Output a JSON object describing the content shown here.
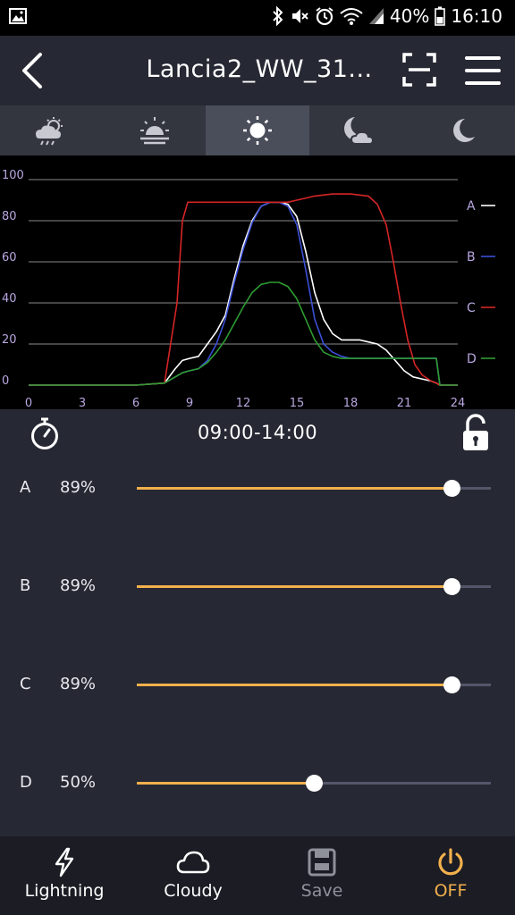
{
  "status_bar": {
    "battery": "40%",
    "time": "16:10"
  },
  "header": {
    "title": "Lancia2_WW_31..."
  },
  "modes": [
    {
      "icon": "cloud-sun-rain-icon",
      "active": false
    },
    {
      "icon": "sunrise-icon",
      "active": false
    },
    {
      "icon": "sun-icon",
      "active": true
    },
    {
      "icon": "moon-cloud-icon",
      "active": false
    },
    {
      "icon": "moon-icon",
      "active": false
    }
  ],
  "chart_data": {
    "type": "line",
    "x_ticks": [
      "0",
      "3",
      "6",
      "9",
      "12",
      "15",
      "18",
      "21",
      "24"
    ],
    "y_ticks": [
      "0",
      "20",
      "40",
      "60",
      "80",
      "100"
    ],
    "xlim": [
      0,
      24
    ],
    "ylim": [
      0,
      100
    ],
    "grid": true,
    "legend": "right",
    "series": [
      {
        "name": "A",
        "color": "#ffffff",
        "x": [
          0,
          6,
          7.6,
          8.2,
          8.6,
          9.0,
          9.5,
          10,
          10.5,
          11,
          11.5,
          12,
          12.5,
          13,
          13.5,
          14,
          14.5,
          15,
          15.5,
          16,
          16.5,
          17,
          17.5,
          18,
          18.5,
          19,
          19.5,
          20,
          20.5,
          21,
          21.5,
          22,
          22.5,
          22.8,
          23,
          24
        ],
        "y": [
          0,
          0,
          1,
          8,
          12,
          13,
          14,
          20,
          26,
          34,
          52,
          68,
          80,
          87,
          89,
          89,
          88,
          82,
          65,
          45,
          32,
          25,
          22,
          22,
          22,
          21,
          20,
          17,
          12,
          7,
          4,
          3,
          2,
          1,
          0,
          0
        ]
      },
      {
        "name": "B",
        "color": "#3b4fd6",
        "x": [
          0,
          6,
          7.6,
          8.2,
          8.6,
          9.0,
          9.5,
          10,
          10.5,
          11,
          11.5,
          12,
          12.5,
          13,
          13.5,
          14,
          14.5,
          15,
          15.5,
          16,
          16.5,
          17,
          17.5,
          18,
          18.5,
          19,
          19.5,
          20,
          20.5,
          21,
          21.5,
          22,
          22.5,
          22.8,
          23,
          24
        ],
        "y": [
          0,
          0,
          1,
          4,
          6,
          7,
          8,
          12,
          20,
          32,
          50,
          66,
          79,
          87,
          89,
          89,
          87,
          78,
          56,
          32,
          20,
          16,
          14,
          13,
          13,
          13,
          13,
          13,
          13,
          13,
          13,
          13,
          13,
          13,
          0,
          0
        ]
      },
      {
        "name": "C",
        "color": "#d42525",
        "x": [
          0,
          6,
          7.6,
          8.3,
          8.6,
          8.9,
          10,
          12,
          13,
          14.5,
          15,
          16,
          17,
          18,
          19,
          19.5,
          20,
          20.4,
          20.8,
          21.2,
          21.6,
          22,
          22.5,
          22.8,
          23,
          24
        ],
        "y": [
          0,
          0,
          1,
          40,
          80,
          89,
          89,
          89,
          89,
          89,
          90,
          92,
          93,
          93,
          92,
          88,
          78,
          60,
          40,
          22,
          10,
          5,
          2,
          1,
          0,
          0
        ]
      },
      {
        "name": "D",
        "color": "#2e9c32",
        "x": [
          0,
          6,
          7.6,
          8.2,
          8.6,
          9.0,
          9.5,
          10,
          10.5,
          11,
          11.5,
          12,
          12.5,
          13,
          13.5,
          14,
          14.5,
          15,
          15.5,
          16,
          16.5,
          17,
          17.5,
          18,
          18.5,
          19,
          19.5,
          20,
          20.5,
          21,
          21.5,
          22,
          22.5,
          22.8,
          23,
          24
        ],
        "y": [
          0,
          0,
          1,
          4,
          6,
          7,
          8,
          11,
          16,
          22,
          30,
          38,
          45,
          49,
          50,
          50,
          48,
          42,
          32,
          22,
          16,
          14,
          13,
          13,
          13,
          13,
          13,
          13,
          13,
          13,
          13,
          13,
          13,
          13,
          0,
          0
        ]
      }
    ]
  },
  "schedule": {
    "time_range": "09:00-14:00"
  },
  "channels": [
    {
      "name": "A",
      "value_label": "89%",
      "level": 0.89
    },
    {
      "name": "B",
      "value_label": "89%",
      "level": 0.89
    },
    {
      "name": "C",
      "value_label": "89%",
      "level": 0.89
    },
    {
      "name": "D",
      "value_label": "50%",
      "level": 0.5
    }
  ],
  "bottom_nav": [
    {
      "label": "Lightning",
      "icon": "lightning-icon",
      "color": "#ffffff"
    },
    {
      "label": "Cloudy",
      "icon": "cloud-icon",
      "color": "#ffffff"
    },
    {
      "label": "Save",
      "icon": "save-icon",
      "color": "#8e909a"
    },
    {
      "label": "OFF",
      "icon": "power-icon",
      "color": "#f2b04c"
    }
  ]
}
